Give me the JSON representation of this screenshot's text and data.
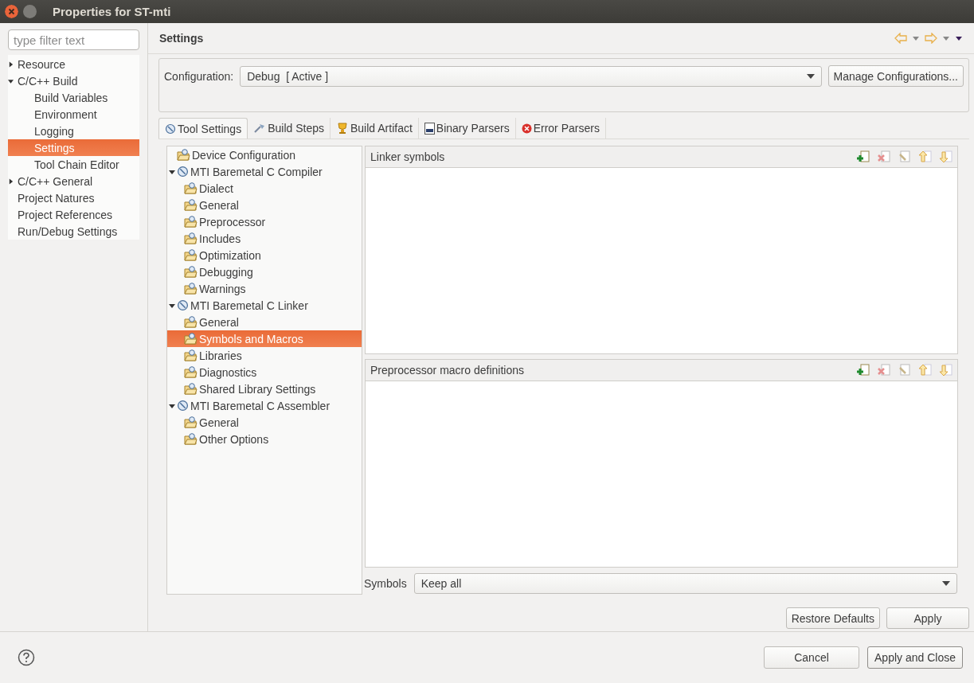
{
  "window": {
    "title": "Properties for ST-mti"
  },
  "filter": {
    "placeholder": "type filter text"
  },
  "nav": [
    {
      "label": "Resource",
      "kind": "group",
      "expanded": false,
      "selected": false
    },
    {
      "label": "C/C++ Build",
      "kind": "group",
      "expanded": true,
      "selected": false,
      "children": [
        {
          "label": "Build Variables",
          "kind": "page",
          "selected": false
        },
        {
          "label": "Environment",
          "kind": "page",
          "selected": false
        },
        {
          "label": "Logging",
          "kind": "page",
          "selected": false
        },
        {
          "label": "Settings",
          "kind": "page",
          "selected": true
        },
        {
          "label": "Tool Chain Editor",
          "kind": "page",
          "selected": false
        }
      ]
    },
    {
      "label": "C/C++ General",
      "kind": "group",
      "expanded": false,
      "selected": false
    },
    {
      "label": "Project Natures",
      "kind": "page",
      "selected": false
    },
    {
      "label": "Project References",
      "kind": "page",
      "selected": false
    },
    {
      "label": "Run/Debug Settings",
      "kind": "page",
      "selected": false
    }
  ],
  "page_title": "Settings",
  "configuration": {
    "label": "Configuration:",
    "value": "Debug  [ Active ]"
  },
  "manage_button": "Manage Configurations...",
  "tabs": [
    {
      "label": "Tool Settings",
      "kind": "tool",
      "selected": true
    },
    {
      "label": "Build Steps",
      "kind": "steps",
      "selected": false
    },
    {
      "label": "Build Artifact",
      "kind": "artifact",
      "selected": false
    },
    {
      "label": "Binary Parsers",
      "kind": "binary",
      "selected": false
    },
    {
      "label": "Error Parsers",
      "kind": "error",
      "selected": false
    }
  ],
  "tool_tree": [
    {
      "label": "Device Configuration",
      "kind": "option",
      "selected": false
    },
    {
      "label": "MTI Baremetal C Compiler",
      "kind": "tool",
      "selected": false,
      "expanded": true,
      "children": [
        {
          "label": "Dialect",
          "kind": "option",
          "selected": false
        },
        {
          "label": "General",
          "kind": "option",
          "selected": false
        },
        {
          "label": "Preprocessor",
          "kind": "option",
          "selected": false
        },
        {
          "label": "Includes",
          "kind": "option",
          "selected": false
        },
        {
          "label": "Optimization",
          "kind": "option",
          "selected": false
        },
        {
          "label": "Debugging",
          "kind": "option",
          "selected": false
        },
        {
          "label": "Warnings",
          "kind": "option",
          "selected": false
        }
      ]
    },
    {
      "label": "MTI Baremetal C Linker",
      "kind": "tool",
      "selected": false,
      "expanded": true,
      "children": [
        {
          "label": "General",
          "kind": "option",
          "selected": false
        },
        {
          "label": "Symbols and Macros",
          "kind": "option",
          "selected": true
        },
        {
          "label": "Libraries",
          "kind": "option",
          "selected": false
        },
        {
          "label": "Diagnostics",
          "kind": "option",
          "selected": false
        },
        {
          "label": "Shared Library Settings",
          "kind": "option",
          "selected": false
        }
      ]
    },
    {
      "label": "MTI Baremetal C Assembler",
      "kind": "tool",
      "selected": false,
      "expanded": true,
      "children": [
        {
          "label": "General",
          "kind": "option",
          "selected": false
        },
        {
          "label": "Other Options",
          "kind": "option",
          "selected": false
        }
      ]
    }
  ],
  "panels": [
    {
      "title": "Linker symbols"
    },
    {
      "title": "Preprocessor macro definitions"
    }
  ],
  "symbols": {
    "label": "Symbols",
    "value": "Keep all"
  },
  "restore_button": "Restore Defaults",
  "apply_button": "Apply",
  "cancel_button": "Cancel",
  "apply_close_button": "Apply and Close"
}
